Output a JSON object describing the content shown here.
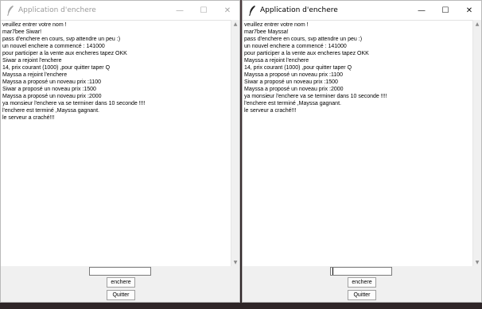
{
  "windows": [
    {
      "title": "Application d'enchere",
      "active": false,
      "lines": [
        "veuillez entrer votre nom !",
        "mar7bee Siwar!",
        "pass d'enchere en cours, svp attendre un peu :)",
        "un nouvel enchere a commencé : 141000",
        "pour participer a la vente aux encheres tapez OKK",
        "Siwar a rejoint l'enchere",
        "14, prix courant (1000) ,pour quitter taper Q",
        "Mayssa a rejoint l'enchere",
        "Mayssa a proposé un noveau prix :1100",
        "Siwar a proposé un noveau prix :1500",
        "Mayssa a proposé un noveau prix :2000",
        "ya monsieur l'enchere va se terminer dans 10 seconde !!!!",
        "l'enchere est terminé ,Mayssa gagnant.",
        "le serveur a craché!!!"
      ],
      "entry_value": "",
      "bid_button": "enchere",
      "quit_button": "Quitter"
    },
    {
      "title": "Application d'enchere",
      "active": true,
      "lines": [
        "veuillez entrer votre nom !",
        "mar7bee Mayssa!",
        "pass d'enchere en cours, svp attendre un peu :)",
        "un nouvel enchere a commencé : 141000",
        "pour participer a la vente aux encheres tapez OKK",
        "Mayssa a rejoint l'enchere",
        "14, prix courant (1000) ,pour quitter taper Q",
        "Mayssa a proposé un noveau prix :1100",
        "Siwar a proposé un noveau prix :1500",
        "Mayssa a proposé un noveau prix :2000",
        "ya monsieur l'enchere va se terminer dans 10 seconde !!!!",
        "l'enchere est terminé ,Mayssa gagnant.",
        "le serveur a craché!!!"
      ],
      "entry_value": "",
      "bid_button": "enchere",
      "quit_button": "Quitter"
    }
  ],
  "icons": {
    "app": "feather-icon",
    "minimize": "minimize-icon",
    "maximize": "maximize-icon",
    "close": "close-icon",
    "scroll_up": "chevron-up-icon",
    "scroll_down": "chevron-down-icon"
  },
  "glyphs": {
    "minimize": "—",
    "maximize": "☐",
    "close": "✕",
    "up": "▲",
    "down": "▼"
  }
}
